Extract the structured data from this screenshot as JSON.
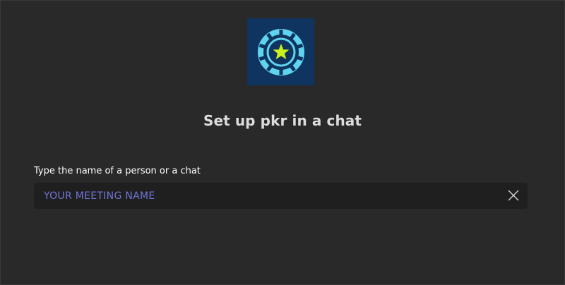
{
  "dialog": {
    "title": "Set up pkr in a chat",
    "app_icon": {
      "name": "poker-chip-star-icon",
      "tile_color": "#0f3460",
      "chip_color": "#5fd4ee",
      "star_color": "#c9f21a"
    }
  },
  "form": {
    "label": "Type the name of a person or a chat",
    "input": {
      "value": "",
      "placeholder": "YOUR MEETING NAME"
    },
    "clear_icon": "close-icon"
  },
  "colors": {
    "background": "#292929",
    "input_background": "#1f1f1f",
    "placeholder": "#7f85f5",
    "title_text": "#dcdcdc"
  }
}
